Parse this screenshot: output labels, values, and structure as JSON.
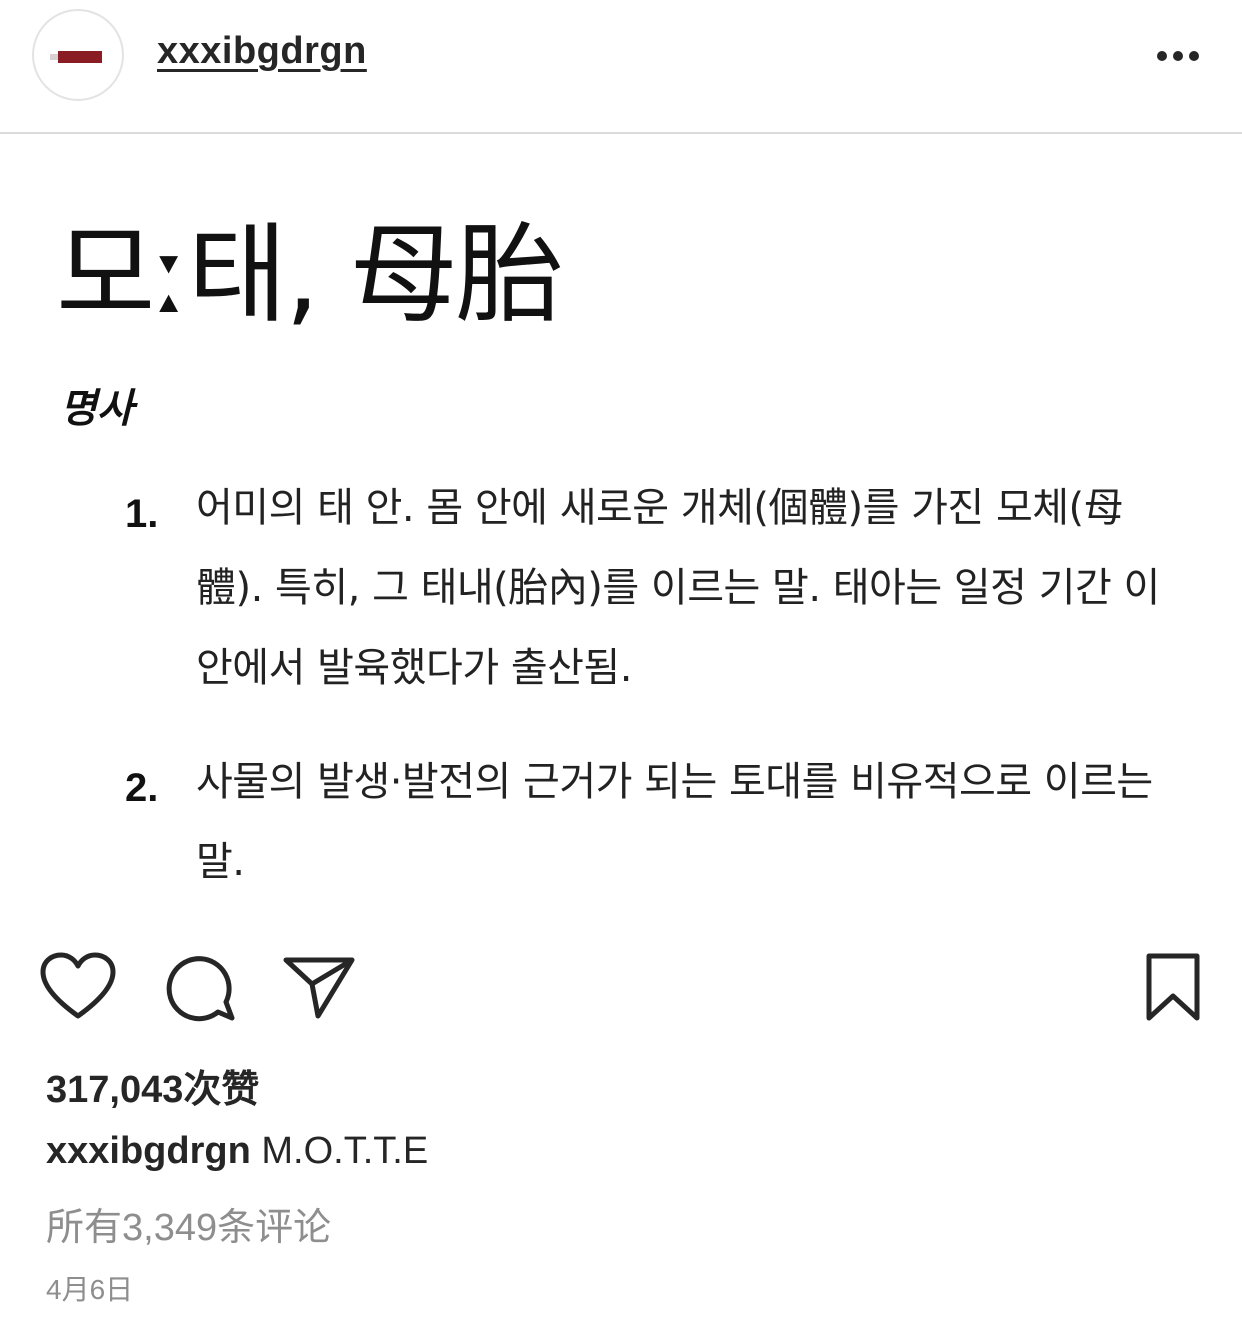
{
  "header": {
    "username": "xxxibgdrgn",
    "more_icon": "more-horizontal-icon"
  },
  "post": {
    "headword": "모ː태, 母胎",
    "part_of_speech": "명사",
    "definitions": [
      {
        "number": "1.",
        "text": "어미의 태 안. 몸 안에 새로운 개체(個體)를 가진 모체(母體). 특히, 그 태내(胎內)를 이르는 말. 태아는 일정 기간 이 안에서 발육했다가 출산됨."
      },
      {
        "number": "2.",
        "text": "사물의 발생·발전의 근거가 되는 토대를 비유적으로 이르는 말."
      }
    ]
  },
  "actions": {
    "like_icon": "heart-icon",
    "comment_icon": "comment-icon",
    "share_icon": "paper-plane-icon",
    "save_icon": "bookmark-icon"
  },
  "meta": {
    "likes": "317,043次赞",
    "caption_user": "xxxibgdrgn",
    "caption_text": "M.O.T.T.E",
    "view_comments": "所有3,349条评论",
    "date": "4月6日"
  },
  "colors": {
    "text_primary": "#262626",
    "text_secondary": "#8e8e8e",
    "divider": "#dbdbdb",
    "avatar_accent": "#8a1c24"
  }
}
